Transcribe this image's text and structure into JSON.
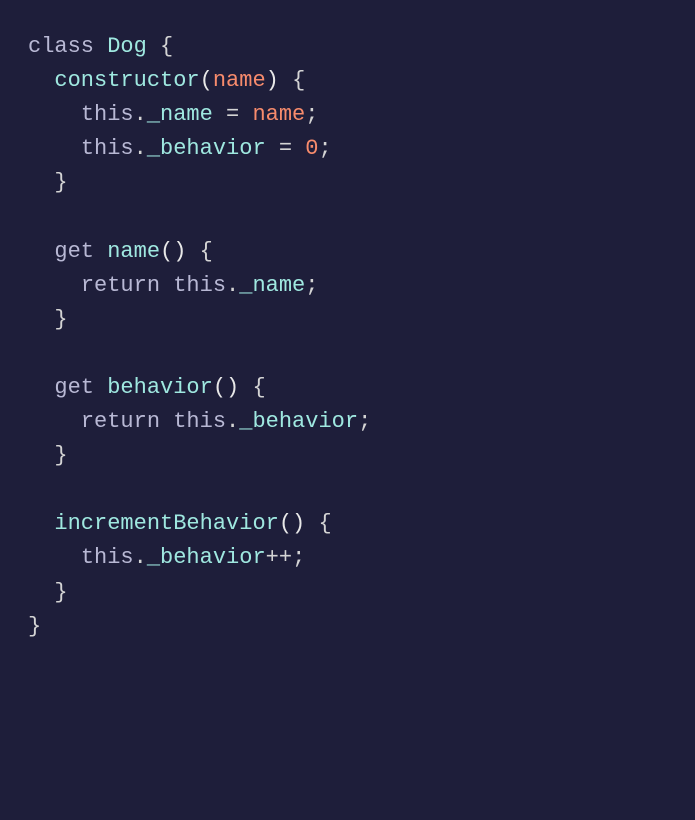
{
  "code": {
    "kw_class": "class",
    "class_name": "Dog",
    "brace_open": "{",
    "brace_close": "}",
    "paren_open": "(",
    "paren_close": ")",
    "constructor": "constructor",
    "param_name": "name",
    "this": "this",
    "dot": ".",
    "prop_name": "_name",
    "prop_behavior": "_behavior",
    "assign": " = ",
    "var_name": "name",
    "zero": "0",
    "semicolon": ";",
    "kw_get": "get",
    "getter_name": "name",
    "getter_behavior": "behavior",
    "kw_return": "return",
    "method_increment": "incrementBehavior",
    "plusplus": "++"
  }
}
